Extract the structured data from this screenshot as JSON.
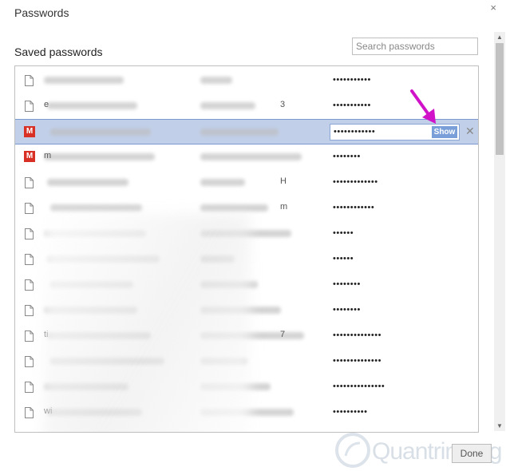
{
  "dialog": {
    "title": "Passwords",
    "close_label": "×"
  },
  "saved": {
    "heading": "Saved passwords"
  },
  "search": {
    "placeholder": "Search passwords"
  },
  "selected_row": {
    "password_mask": "••••••••••••",
    "show_label": "Show",
    "remove_label": "✕"
  },
  "rows": [
    {
      "icon": "page-icon",
      "mask": "•••••••••••",
      "site_hint": "",
      "user_hint": ""
    },
    {
      "icon": "page-icon",
      "mask": "•••••••••••",
      "site_hint": "e",
      "user_hint": "3"
    },
    {
      "icon": "gmail-icon",
      "mask": "••••••••••••",
      "site_hint": "",
      "user_hint": ""
    },
    {
      "icon": "gmail-icon",
      "mask": "••••••••",
      "site_hint": "m",
      "user_hint": ""
    },
    {
      "icon": "page-icon",
      "mask": "•••••••••••••",
      "site_hint": "",
      "user_hint": "H"
    },
    {
      "icon": "page-icon",
      "mask": "••••••••••••",
      "site_hint": "",
      "user_hint": "m"
    },
    {
      "icon": "page-icon",
      "mask": "••••••",
      "site_hint": "",
      "user_hint": ""
    },
    {
      "icon": "page-icon",
      "mask": "••••••",
      "site_hint": "",
      "user_hint": ""
    },
    {
      "icon": "page-icon",
      "mask": "••••••••",
      "site_hint": "",
      "user_hint": ""
    },
    {
      "icon": "page-icon",
      "mask": "••••••••",
      "site_hint": "",
      "user_hint": ""
    },
    {
      "icon": "page-icon",
      "mask": "••••••••••••••",
      "site_hint": "ti",
      "user_hint": "7"
    },
    {
      "icon": "page-icon",
      "mask": "••••••••••••••",
      "site_hint": "",
      "user_hint": ""
    },
    {
      "icon": "page-icon",
      "mask": "•••••••••••••••",
      "site_hint": "",
      "user_hint": ""
    },
    {
      "icon": "page-icon",
      "mask": "••••••••••",
      "site_hint": "wi",
      "user_hint": ""
    }
  ],
  "footer": {
    "done_label": "Done"
  },
  "watermark": {
    "text": "Quantrimang"
  },
  "colors": {
    "selection": "#c1cfe9",
    "show_button": "#7a9fd8",
    "annotation_arrow": "#d012c8",
    "gmail": "#d93025"
  }
}
